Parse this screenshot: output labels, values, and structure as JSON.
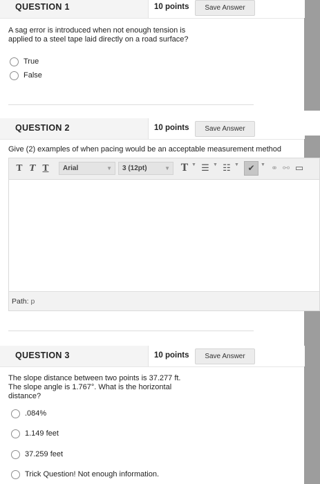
{
  "questions": [
    {
      "title": "QUESTION 1",
      "points": "10 points",
      "save_label": "Save Answer",
      "text": "A sag error is introduced when not enough tension is applied to a steel tape laid directly on a road surface?",
      "options": [
        "True",
        "False"
      ]
    },
    {
      "title": "QUESTION 2",
      "points": "10 points",
      "save_label": "Save Answer",
      "text": "Give (2) examples of when pacing would be an acceptable measurement method",
      "editor": {
        "font_family": "Arial",
        "font_size": "3 (12pt)",
        "path_label": "Path:",
        "path_value": "p"
      }
    },
    {
      "title": "QUESTION 3",
      "points": "10 points",
      "save_label": "Save Answer",
      "text": "The slope distance between two points is 37.277 ft. The slope angle is 1.767°. What is the horizontal distance?",
      "options": [
        ".084%",
        "1.149 feet",
        "37.259 feet",
        "Trick Question! Not enough information."
      ]
    }
  ],
  "icons": [
    "bold-t-icon",
    "italic-t-icon",
    "underline-t-icon",
    "text-color-icon",
    "bullet-list-icon",
    "numbered-list-icon",
    "spellcheck-icon",
    "link-icon",
    "unlink-icon",
    "preview-icon"
  ]
}
